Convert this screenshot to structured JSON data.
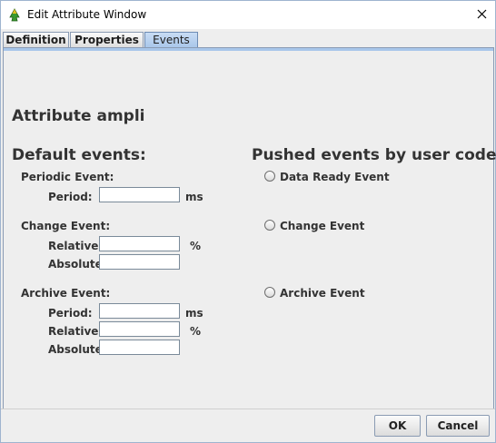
{
  "window": {
    "title": "Edit Attribute Window"
  },
  "tabs": [
    {
      "label": "Definition"
    },
    {
      "label": "Properties"
    },
    {
      "label": "Events",
      "active": true
    }
  ],
  "attribute": {
    "title": "Attribute ampli"
  },
  "default_events": {
    "heading": "Default events:",
    "periodic": {
      "label": "Periodic Event:",
      "period_label": "Period:",
      "period_value": "",
      "period_unit": "ms"
    },
    "change": {
      "label": "Change Event:",
      "relative_label": "Relative:",
      "relative_value": "",
      "relative_unit": "%",
      "absolute_label": "Absolute:",
      "absolute_value": ""
    },
    "archive": {
      "label": "Archive Event:",
      "period_label": "Period:",
      "period_value": "",
      "period_unit": "ms",
      "relative_label": "Relative:",
      "relative_value": "",
      "relative_unit": "%",
      "absolute_label": "Absolute:",
      "absolute_value": ""
    }
  },
  "pushed_events": {
    "heading": "Pushed events by user code:",
    "options": [
      {
        "label": "Data Ready Event",
        "checked": false
      },
      {
        "label": "Change Event",
        "checked": false
      },
      {
        "label": "Archive Event",
        "checked": false
      }
    ]
  },
  "buttons": {
    "ok": "OK",
    "cancel": "Cancel"
  },
  "icons": {
    "app": "tree-icon",
    "close": "close-icon"
  },
  "colors": {
    "active_tab": "#a8c6ea",
    "window_bg": "#eeeeee",
    "border": "#8a9bb3"
  }
}
